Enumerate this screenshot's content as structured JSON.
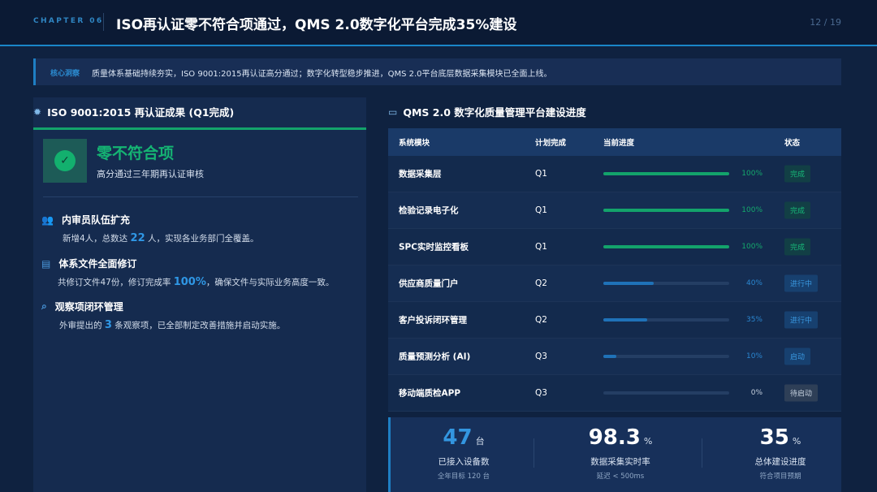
{
  "header": {
    "chapter": "CHAPTER 06",
    "title": "ISO再认证零不符合项通过，QMS 2.0数字化平台完成35%建设",
    "page": "12 / 19"
  },
  "insight": {
    "label": "核心洞察",
    "text": "质量体系基础持续夯实，ISO 9001:2015再认证高分通过；数字化转型稳步推进，QMS 2.0平台底层数据采集模块已全面上线。"
  },
  "left": {
    "icon": "gear-icon",
    "heading": "ISO 9001:2015 再认证成果 (Q1完成)",
    "hero": {
      "title": "零不符合项",
      "subtitle": "高分通过三年期再认证审核"
    },
    "items": [
      {
        "icon": "users-icon",
        "title": "内审员队伍扩充",
        "pre": "新增4人，总数达 ",
        "num": "22",
        "post": " 人，实现各业务部门全覆盖。"
      },
      {
        "icon": "document-icon",
        "title": "体系文件全面修订",
        "pre": "共修订文件47份，修订完成率 ",
        "num": "100%",
        "post": "，确保文件与实际业务高度一致。"
      },
      {
        "icon": "search-icon",
        "title": "观察项闭环管理",
        "pre": "外审提出的 ",
        "num": "3",
        "post": " 条观察项，已全部制定改善措施并启动实施。"
      }
    ]
  },
  "right": {
    "icon": "monitor-icon",
    "heading": "QMS 2.0 数字化质量管理平台建设进度",
    "columns": [
      "系统模块",
      "计划完成",
      "当前进度",
      "状态"
    ],
    "rows": [
      {
        "module": "数据采集层",
        "plan": "Q1",
        "progress": 100,
        "pct": "100%",
        "status": "完成",
        "kind": "done"
      },
      {
        "module": "检验记录电子化",
        "plan": "Q1",
        "progress": 100,
        "pct": "100%",
        "status": "完成",
        "kind": "done"
      },
      {
        "module": "SPC实时监控看板",
        "plan": "Q1",
        "progress": 100,
        "pct": "100%",
        "status": "完成",
        "kind": "done"
      },
      {
        "module": "供应商质量门户",
        "plan": "Q2",
        "progress": 40,
        "pct": "40%",
        "status": "进行中",
        "kind": "progress"
      },
      {
        "module": "客户投诉闭环管理",
        "plan": "Q2",
        "progress": 35,
        "pct": "35%",
        "status": "进行中",
        "kind": "progress"
      },
      {
        "module": "质量预测分析 (AI)",
        "plan": "Q3",
        "progress": 10,
        "pct": "10%",
        "status": "启动",
        "kind": "start"
      },
      {
        "module": "移动端质检APP",
        "plan": "Q3",
        "progress": 0,
        "pct": "0%",
        "status": "待启动",
        "kind": "pending"
      }
    ],
    "stats": [
      {
        "value": "47",
        "unit": "台",
        "label": "已接入设备数",
        "sub": "全年目标 120 台",
        "accent": true
      },
      {
        "value": "98.3",
        "unit": "%",
        "label": "数据采集实时率",
        "sub": "延迟 < 500ms",
        "accent": false
      },
      {
        "value": "35",
        "unit": "%",
        "label": "总体建设进度",
        "sub": "符合项目预期",
        "accent": false
      }
    ]
  },
  "colors": {
    "done_bar": "#13a36b",
    "progress_bar": "#1f72b8",
    "start_bar": "#1f72b8",
    "done_text": "#14a86c",
    "progress_text": "#2a86d0",
    "done_badge_bg": "#123f45",
    "done_badge_fg": "#17b878",
    "progress_badge_bg": "#17406f",
    "progress_badge_fg": "#3a98e0",
    "start_badge_bg": "#17406f",
    "start_badge_fg": "#3a98e0",
    "pending_badge_bg": "#2e3f57",
    "pending_badge_fg": "#c4cfdd",
    "accent_value": "#3396e0"
  }
}
